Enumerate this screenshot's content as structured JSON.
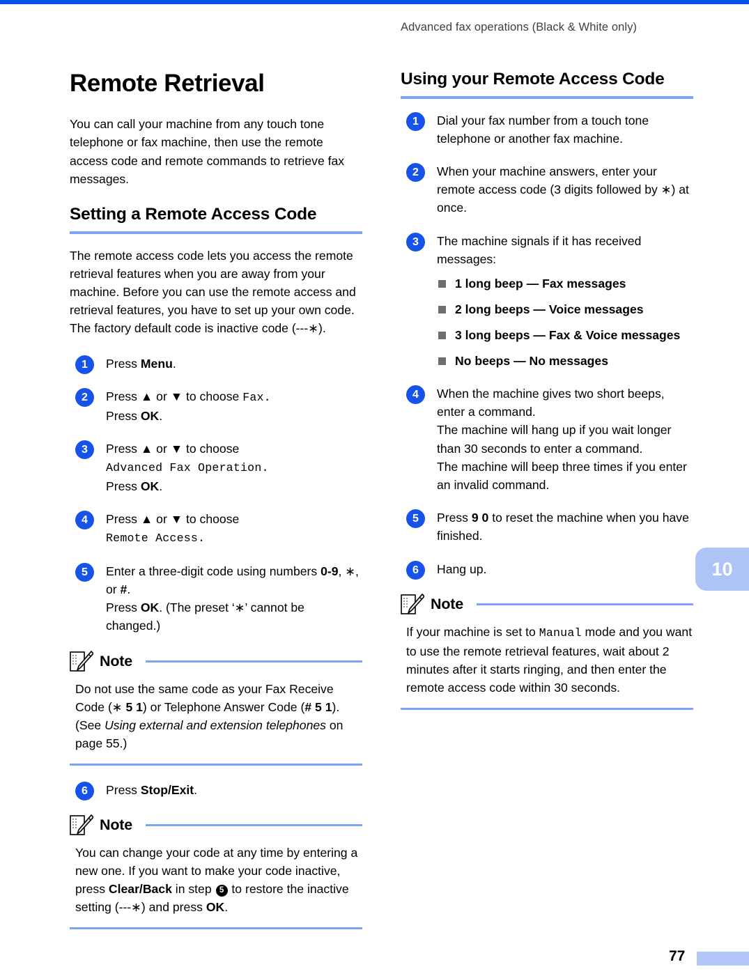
{
  "header": {
    "running_title": "Advanced fax operations (Black & White only)"
  },
  "colors": {
    "top_bar": "#0050e6",
    "rule": "#7ea4f2",
    "step_circle": "#1753e8",
    "bullet_square": "#6e6e6e",
    "chapter_tab": "#aec4f7",
    "footer_bar": "#b3c8f8"
  },
  "left_column": {
    "chapter_title": "Remote Retrieval",
    "intro_paragraph": "You can call your machine from any touch tone telephone or fax machine, then use the remote access code and remote commands to retrieve fax messages.",
    "section_title": "Setting a Remote Access Code",
    "section_paragraph": "The remote access code lets you access the remote retrieval features when you are away from your machine. Before you can use the remote access and retrieval features, you have to set up your own code. The factory default code is inactive code (---∗).",
    "steps": [
      {
        "number": "1",
        "lines": [
          {
            "parts": [
              {
                "t": "Press ",
                "s": "plain"
              },
              {
                "t": "Menu",
                "s": "bold"
              },
              {
                "t": ".",
                "s": "plain"
              }
            ]
          }
        ]
      },
      {
        "number": "2",
        "lines": [
          {
            "parts": [
              {
                "t": "Press ▲ or ▼ to choose ",
                "s": "plain"
              },
              {
                "t": "Fax",
                "s": "lcd"
              },
              {
                "t": ".",
                "s": "lcd"
              }
            ]
          },
          {
            "parts": [
              {
                "t": "Press ",
                "s": "plain"
              },
              {
                "t": "OK",
                "s": "bold"
              },
              {
                "t": ".",
                "s": "plain"
              }
            ]
          }
        ]
      },
      {
        "number": "3",
        "lines": [
          {
            "parts": [
              {
                "t": "Press ▲ or ▼ to choose",
                "s": "plain"
              }
            ]
          },
          {
            "parts": [
              {
                "t": "Advanced Fax Operation.",
                "s": "lcd"
              }
            ]
          },
          {
            "parts": [
              {
                "t": "Press ",
                "s": "plain"
              },
              {
                "t": "OK",
                "s": "bold"
              },
              {
                "t": ".",
                "s": "plain"
              }
            ]
          }
        ]
      },
      {
        "number": "4",
        "lines": [
          {
            "parts": [
              {
                "t": "Press ▲ or ▼ to choose",
                "s": "plain"
              }
            ]
          },
          {
            "parts": [
              {
                "t": "Remote Access.",
                "s": "lcd"
              }
            ]
          }
        ]
      },
      {
        "number": "5",
        "lines": [
          {
            "parts": [
              {
                "t": "Enter a three-digit code using numbers ",
                "s": "plain"
              },
              {
                "t": "0-9",
                "s": "bold"
              },
              {
                "t": ", ∗, or ",
                "s": "plain"
              },
              {
                "t": "#",
                "s": "bold"
              },
              {
                "t": ".",
                "s": "plain"
              }
            ]
          },
          {
            "parts": [
              {
                "t": "Press ",
                "s": "plain"
              },
              {
                "t": "OK",
                "s": "bold"
              },
              {
                "t": ". (The preset ‘∗’ cannot be changed.)",
                "s": "plain"
              }
            ]
          }
        ]
      }
    ],
    "note_1": {
      "label": "Note",
      "body_parts": [
        {
          "t": "Do not use the same code as your Fax Receive Code (∗ ",
          "s": "plain"
        },
        {
          "t": "5 1",
          "s": "bold"
        },
        {
          "t": ") or Telephone Answer Code (",
          "s": "plain"
        },
        {
          "t": "# 5 1",
          "s": "bold"
        },
        {
          "t": "). (See ",
          "s": "plain"
        },
        {
          "t": "Using external and extension telephones",
          "s": "italic"
        },
        {
          "t": " on page 55.)",
          "s": "plain"
        }
      ]
    },
    "step_6": {
      "number": "6",
      "parts": [
        {
          "t": "Press ",
          "s": "plain"
        },
        {
          "t": "Stop/Exit",
          "s": "bold"
        },
        {
          "t": ".",
          "s": "plain"
        }
      ]
    },
    "note_2": {
      "label": "Note",
      "body_parts": [
        {
          "t": "You can change your code at any time by entering a new one. If you want to make your code inactive, press ",
          "s": "plain"
        },
        {
          "t": "Clear/Back",
          "s": "bold"
        },
        {
          "t": " in step ",
          "s": "plain"
        },
        {
          "t": "5",
          "s": "stepref"
        },
        {
          "t": " to restore the inactive setting (---∗) and press ",
          "s": "plain"
        },
        {
          "t": "OK",
          "s": "bold"
        },
        {
          "t": ".",
          "s": "plain"
        }
      ]
    }
  },
  "right_column": {
    "section_title": "Using your Remote Access Code",
    "steps": [
      {
        "number": "1",
        "lines": [
          {
            "parts": [
              {
                "t": "Dial your fax number from a touch tone telephone or another fax machine.",
                "s": "plain"
              }
            ]
          }
        ]
      },
      {
        "number": "2",
        "lines": [
          {
            "parts": [
              {
                "t": "When your machine answers, enter your remote access code (3 digits followed by ∗) at once.",
                "s": "plain"
              }
            ]
          }
        ]
      },
      {
        "number": "3",
        "lines": [
          {
            "parts": [
              {
                "t": "The machine signals if it has received messages:",
                "s": "plain"
              }
            ]
          }
        ],
        "bullets": [
          "1 long beep — Fax messages",
          "2 long beeps — Voice messages",
          "3 long beeps — Fax & Voice messages",
          "No beeps — No messages"
        ]
      },
      {
        "number": "4",
        "lines": [
          {
            "parts": [
              {
                "t": "When the machine gives two short beeps, enter a command.",
                "s": "plain"
              }
            ]
          },
          {
            "parts": [
              {
                "t": "The machine will hang up if you wait longer than 30 seconds to enter a command.",
                "s": "plain"
              }
            ]
          },
          {
            "parts": [
              {
                "t": "The machine will beep three times if you enter an invalid command.",
                "s": "plain"
              }
            ]
          }
        ]
      },
      {
        "number": "5",
        "lines": [
          {
            "parts": [
              {
                "t": "Press ",
                "s": "plain"
              },
              {
                "t": "9 0",
                "s": "bold"
              },
              {
                "t": " to reset the machine when you have finished.",
                "s": "plain"
              }
            ]
          }
        ]
      },
      {
        "number": "6",
        "lines": [
          {
            "parts": [
              {
                "t": "Hang up.",
                "s": "plain"
              }
            ]
          }
        ]
      }
    ],
    "note": {
      "label": "Note",
      "body_parts": [
        {
          "t": "If your machine is set to ",
          "s": "plain"
        },
        {
          "t": "Manual",
          "s": "lcd"
        },
        {
          "t": " mode and you want to use the remote retrieval features, wait about 2 minutes after it starts ringing, and then enter the remote access code within 30 seconds.",
          "s": "plain"
        }
      ]
    }
  },
  "chapter_tab": {
    "number": "10"
  },
  "footer": {
    "page_number": "77"
  }
}
